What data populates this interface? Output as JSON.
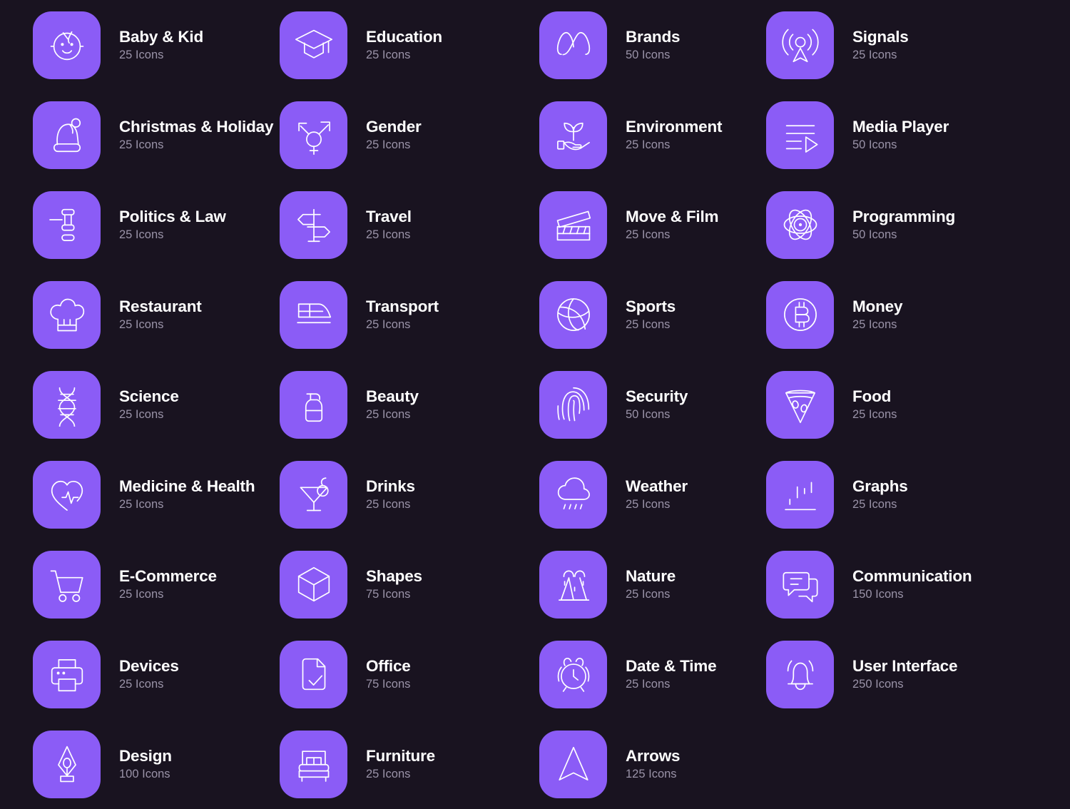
{
  "theme": {
    "background": "#191320",
    "tile_color": "#8B5CF6",
    "icon_color": "#FFFFFF",
    "title_color": "#FFFFFF",
    "count_color": "#9A93A8"
  },
  "grid": {
    "columns": 4,
    "rows": 9,
    "total_categories": 35
  },
  "categories": [
    {
      "title": "Baby & Kid",
      "count": "25 Icons",
      "icon": "baby-face-icon"
    },
    {
      "title": "Education",
      "count": "25 Icons",
      "icon": "graduation-cap-icon"
    },
    {
      "title": "Brands",
      "count": "50 Icons",
      "icon": "meta-infinity-icon"
    },
    {
      "title": "Signals",
      "count": "25 Icons",
      "icon": "broadcast-antenna-icon"
    },
    {
      "title": "Christmas & Holiday",
      "count": "25 Icons",
      "icon": "santa-hat-icon"
    },
    {
      "title": "Gender",
      "count": "25 Icons",
      "icon": "transgender-symbol-icon"
    },
    {
      "title": "Environment",
      "count": "25 Icons",
      "icon": "sprout-in-hand-icon"
    },
    {
      "title": "Media Player",
      "count": "50 Icons",
      "icon": "playlist-play-icon"
    },
    {
      "title": "Politics & Law",
      "count": "25 Icons",
      "icon": "gavel-icon"
    },
    {
      "title": "Travel",
      "count": "25 Icons",
      "icon": "signpost-icon"
    },
    {
      "title": "Move & Film",
      "count": "25 Icons",
      "icon": "clapperboard-icon"
    },
    {
      "title": "Programming",
      "count": "50 Icons",
      "icon": "atom-react-icon"
    },
    {
      "title": "Restaurant",
      "count": "25 Icons",
      "icon": "chef-hat-icon"
    },
    {
      "title": "Transport",
      "count": "25 Icons",
      "icon": "train-icon"
    },
    {
      "title": "Sports",
      "count": "25 Icons",
      "icon": "volleyball-icon"
    },
    {
      "title": "Money",
      "count": "25 Icons",
      "icon": "bitcoin-coin-icon"
    },
    {
      "title": "Science",
      "count": "25 Icons",
      "icon": "dna-helix-icon"
    },
    {
      "title": "Beauty",
      "count": "25 Icons",
      "icon": "lotion-pump-bottle-icon"
    },
    {
      "title": "Security",
      "count": "50 Icons",
      "icon": "fingerprint-icon"
    },
    {
      "title": "Food",
      "count": "25 Icons",
      "icon": "pizza-slice-icon"
    },
    {
      "title": "Medicine & Health",
      "count": "25 Icons",
      "icon": "heart-pulse-icon"
    },
    {
      "title": "Drinks",
      "count": "25 Icons",
      "icon": "cocktail-glass-icon"
    },
    {
      "title": "Weather",
      "count": "25 Icons",
      "icon": "rain-cloud-icon"
    },
    {
      "title": "Graphs",
      "count": "25 Icons",
      "icon": "bar-chart-icon"
    },
    {
      "title": "E-Commerce",
      "count": "25 Icons",
      "icon": "shopping-cart-icon"
    },
    {
      "title": "Shapes",
      "count": "75 Icons",
      "icon": "cube-icon"
    },
    {
      "title": "Nature",
      "count": "25 Icons",
      "icon": "mountain-waterfall-icon"
    },
    {
      "title": "Communication",
      "count": "150 Icons",
      "icon": "chat-bubbles-icon"
    },
    {
      "title": "Devices",
      "count": "25 Icons",
      "icon": "printer-icon"
    },
    {
      "title": "Office",
      "count": "75 Icons",
      "icon": "document-check-icon"
    },
    {
      "title": "Date & Time",
      "count": "25 Icons",
      "icon": "alarm-clock-icon"
    },
    {
      "title": "User Interface",
      "count": "250 Icons",
      "icon": "bell-icon"
    },
    {
      "title": "Design",
      "count": "100 Icons",
      "icon": "pen-nib-icon"
    },
    {
      "title": "Furniture",
      "count": "25 Icons",
      "icon": "bed-icon"
    },
    {
      "title": "Arrows",
      "count": "125 Icons",
      "icon": "navigation-arrow-icon"
    }
  ]
}
